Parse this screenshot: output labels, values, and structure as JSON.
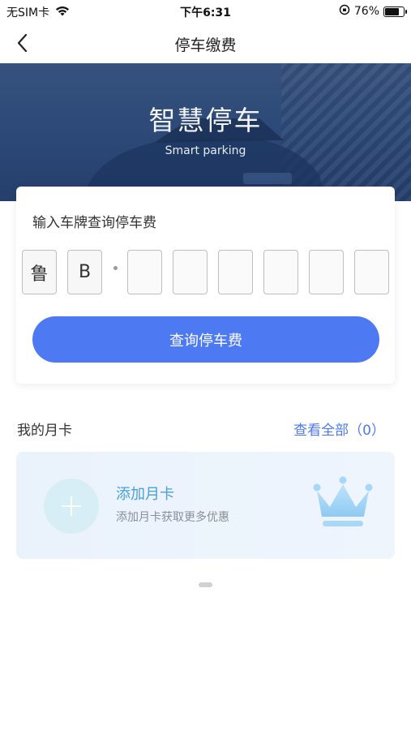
{
  "status_bar": {
    "carrier": "无SIM卡",
    "time": "下午6:31",
    "battery": "76%",
    "battery_level": 0.76
  },
  "nav": {
    "title": "停车缴费"
  },
  "banner": {
    "title": "智慧停车",
    "subtitle": "Smart parking"
  },
  "query": {
    "label": "输入车牌查询停车费",
    "plate": [
      "鲁",
      "B",
      "",
      "",
      "",
      "",
      "",
      ""
    ],
    "button": "查询停车费"
  },
  "monthly": {
    "title": "我的月卡",
    "view_all": "查看全部（0）",
    "add_title": "添加月卡",
    "add_desc": "添加月卡获取更多优惠"
  },
  "colors": {
    "accent": "#4d79f2",
    "banner": "#2d4a78",
    "monthly_title": "#4a9fd6"
  },
  "icons": {
    "back": "chevron-left-icon",
    "wifi": "wifi-icon",
    "orientation_lock": "orientation-lock-icon",
    "battery": "battery-icon",
    "add": "plus-icon",
    "crown": "crown-icon"
  }
}
